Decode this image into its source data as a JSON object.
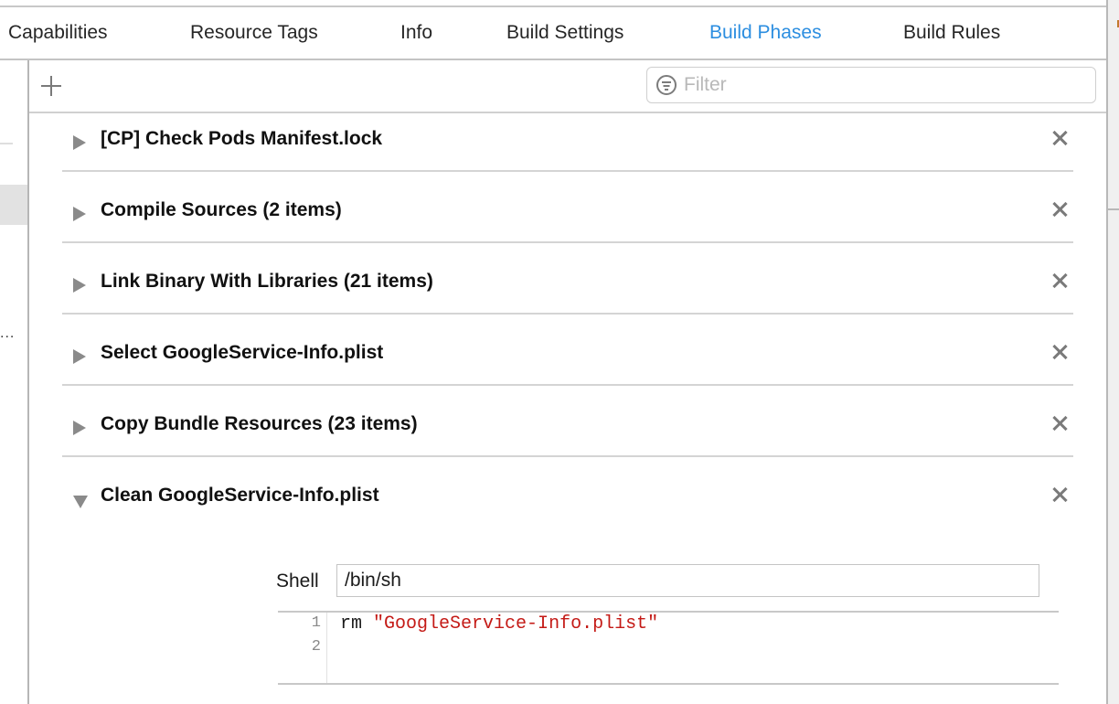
{
  "tabs": [
    {
      "label": "Capabilities",
      "active": false
    },
    {
      "label": "Resource Tags",
      "active": false
    },
    {
      "label": "Info",
      "active": false
    },
    {
      "label": "Build Settings",
      "active": false
    },
    {
      "label": "Build Phases",
      "active": true
    },
    {
      "label": "Build Rules",
      "active": false
    }
  ],
  "colors": {
    "accent": "#2c8ee0",
    "string_literal": "#c41a16"
  },
  "sidebar": {
    "ellipsis": "..."
  },
  "toolbar": {
    "add_icon": "plus-icon",
    "filter": {
      "icon": "filter-icon",
      "placeholder": "Filter",
      "value": ""
    }
  },
  "phases": [
    {
      "title": "[CP] Check Pods Manifest.lock",
      "expanded": false
    },
    {
      "title": "Compile Sources (2 items)",
      "expanded": false
    },
    {
      "title": "Link Binary With Libraries (21 items)",
      "expanded": false
    },
    {
      "title": "Select GoogleService-Info.plist",
      "expanded": false
    },
    {
      "title": "Copy Bundle Resources (23 items)",
      "expanded": false
    },
    {
      "title": "Clean GoogleService-Info.plist",
      "expanded": true
    }
  ],
  "script_phase": {
    "shell_label": "Shell",
    "shell_value": "/bin/sh",
    "line_numbers": [
      "1",
      "2"
    ],
    "code_command": "rm",
    "code_string": "\"GoogleService-Info.plist\""
  }
}
